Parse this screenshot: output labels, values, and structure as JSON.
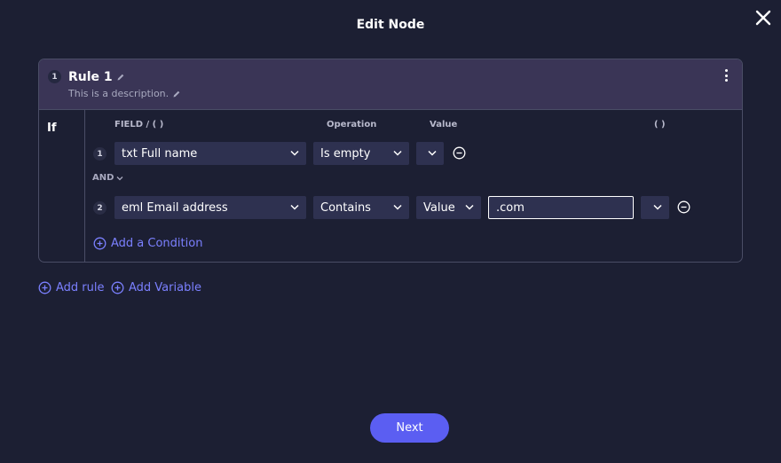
{
  "modal": {
    "title": "Edit Node",
    "close_icon": "close-icon"
  },
  "rule": {
    "number": "1",
    "title": "Rule 1",
    "description": "This is a description.",
    "if_label": "If",
    "menu_icon": "kebab-menu-icon",
    "columns": {
      "field": "FIELD / ( )",
      "operation": "Operation",
      "value": "Value",
      "paren": "( )"
    },
    "conditions": [
      {
        "number": "1",
        "field": "txt Full name",
        "operation": "Is empty",
        "value_type": "",
        "value": ""
      },
      {
        "number": "2",
        "field": "eml Email address",
        "operation": "Contains",
        "value_type": "Value",
        "value": ".com",
        "paren": ""
      }
    ],
    "connector": "AND",
    "add_condition_label": "Add a Condition"
  },
  "actions": {
    "add_rule_label": "Add rule",
    "add_variable_label": "Add Variable"
  },
  "footer": {
    "next_label": "Next"
  },
  "colors": {
    "background": "#1c1f33",
    "rule_header": "#3a3556",
    "accent": "#5b5ef2",
    "link": "#7b80ff"
  }
}
